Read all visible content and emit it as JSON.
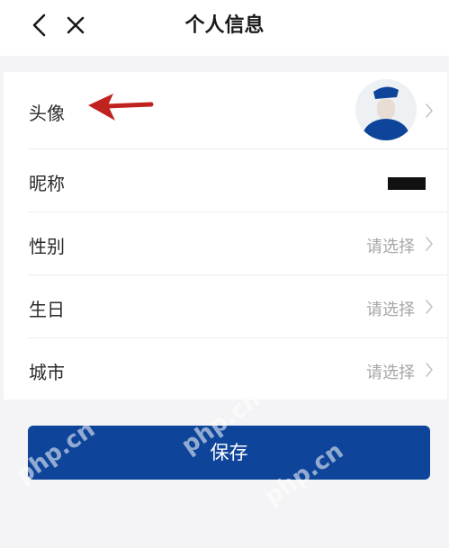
{
  "header": {
    "title": "个人信息",
    "back_icon": "chevron-left-icon",
    "close_icon": "close-icon"
  },
  "profile": {
    "avatar": {
      "label": "头像"
    },
    "nickname": {
      "label": "昵称"
    },
    "gender": {
      "label": "性别",
      "placeholder": "请选择"
    },
    "birthday": {
      "label": "生日",
      "placeholder": "请选择"
    },
    "city": {
      "label": "城市",
      "placeholder": "请选择"
    }
  },
  "save_button": {
    "label": "保存"
  },
  "watermark": "php.cn",
  "colors": {
    "primary": "#0e459a",
    "annotation_arrow": "#c0231f",
    "placeholder_text": "#a6a6a6",
    "background": "#f4f4f6"
  }
}
